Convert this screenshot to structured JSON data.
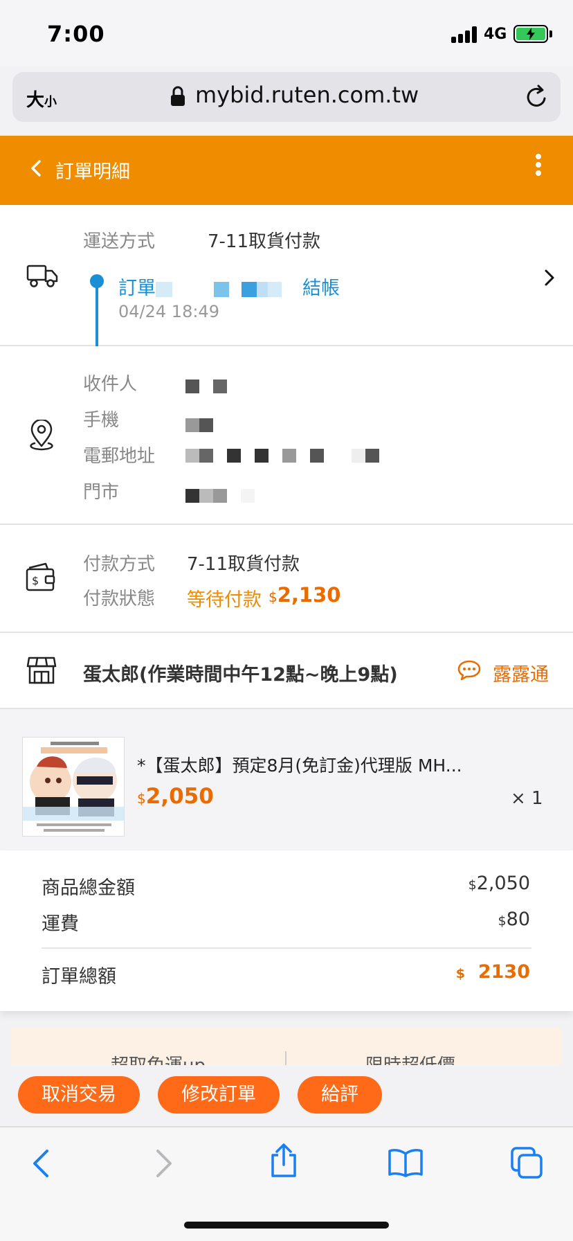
{
  "status_bar": {
    "time": "7:00",
    "network": "4G"
  },
  "browser": {
    "text_size": "大",
    "text_size_small": "小",
    "url": "mybid.ruten.com.tw"
  },
  "header": {
    "title": "訂單明細"
  },
  "shipping": {
    "label": "運送方式",
    "method": "7-11取貨付款",
    "status_prefix": "訂單",
    "status_suffix": "結帳",
    "status_time": "04/24 18:49"
  },
  "recipient": {
    "name_label": "收件人",
    "phone_label": "手機",
    "address_label": "電郵地址",
    "store_label": "門市"
  },
  "payment": {
    "method_label": "付款方式",
    "method": "7-11取貨付款",
    "status_label": "付款狀態",
    "status": "等待付款",
    "currency": "$",
    "amount": "2,130"
  },
  "seller": {
    "name": "蛋太郎(作業時間中午12點~晚上9點)",
    "chat_label": "露露通"
  },
  "product": {
    "title": "*【蛋太郎】預定8月(免訂金)代理版 MH...",
    "currency": "$",
    "price": "2,050",
    "quantity": "× 1"
  },
  "totals": {
    "subtotal_label": "商品總金額",
    "subtotal_currency": "$",
    "subtotal": "2,050",
    "shipping_label": "運費",
    "shipping_currency": "$",
    "shipping": "80",
    "total_label": "訂單總額",
    "total_currency": "$",
    "total": "2130"
  },
  "promo": {
    "left": "超取免運up",
    "right": "限時超低價"
  },
  "actions": {
    "cancel": "取消交易",
    "modify": "修改訂單",
    "rate": "給評"
  },
  "colors": {
    "brand_orange": "#f08c00",
    "accent_orange": "#ea6b00",
    "button_orange": "#ff6a18",
    "link_blue": "#1a8fd6"
  }
}
